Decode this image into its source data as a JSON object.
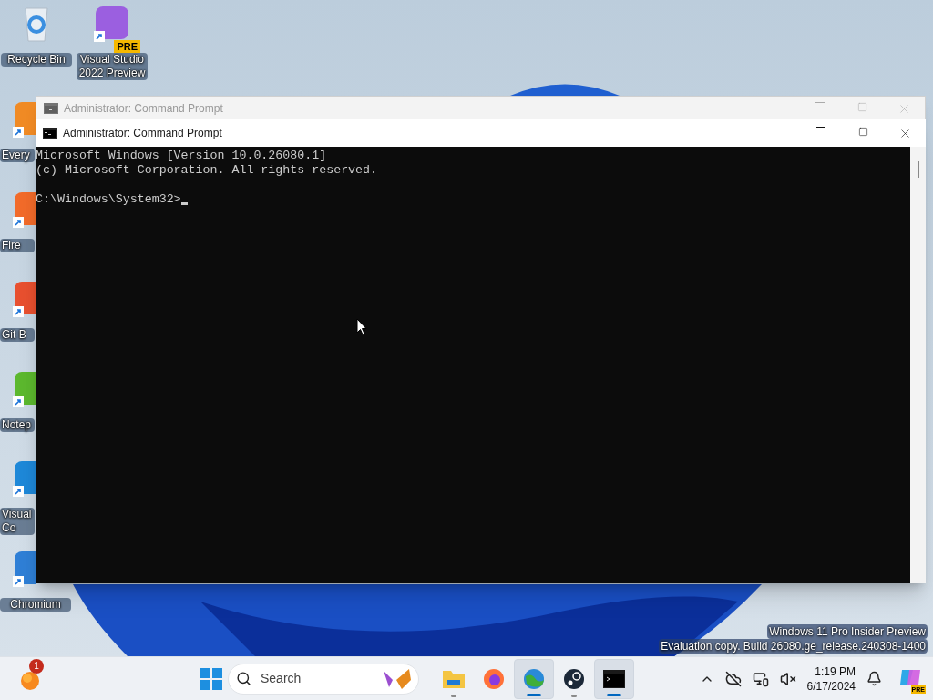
{
  "desktop": {
    "icons": [
      {
        "label": "Recycle Bin",
        "shortcut": false,
        "covered": false
      },
      {
        "label": "Visual Studio 2022 Preview",
        "shortcut": true,
        "covered": false,
        "badge": "PRE"
      },
      {
        "label": "Every",
        "shortcut": true,
        "covered": true
      },
      {
        "label": "Fire",
        "shortcut": true,
        "covered": true
      },
      {
        "label": "Git B",
        "shortcut": true,
        "covered": true
      },
      {
        "label": "Notep",
        "shortcut": true,
        "covered": true
      },
      {
        "label": "Visual Co",
        "shortcut": true,
        "covered": true
      },
      {
        "label": "Chromium",
        "shortcut": true,
        "covered": false
      }
    ]
  },
  "windows": [
    {
      "title": "Administrator: Command Prompt",
      "active": false
    },
    {
      "title": "Administrator: Command Prompt",
      "active": true,
      "console": {
        "output": [
          "Microsoft Windows [Version 10.0.26080.1]",
          "(c) Microsoft Corporation. All rights reserved."
        ],
        "prompt": "C:\\Windows\\System32>"
      }
    }
  ],
  "watermark": [
    "Windows 11 Pro Insider Preview",
    "Evaluation copy. Build 26080.ge_release.240308-1400"
  ],
  "taskbar": {
    "widgets_badge": "1",
    "search": {
      "placeholder": "Search"
    },
    "apps": [
      {
        "kind": "folder",
        "running": true,
        "active": false
      },
      {
        "kind": "firefox",
        "running": false,
        "active": false
      },
      {
        "kind": "globe",
        "running": true,
        "active": true
      },
      {
        "kind": "steam",
        "running": true,
        "active": false
      },
      {
        "kind": "terminal",
        "running": true,
        "active": true
      }
    ],
    "clock": {
      "time": "1:19 PM",
      "date": "6/17/2024"
    },
    "copilot_badge": "PRE"
  }
}
